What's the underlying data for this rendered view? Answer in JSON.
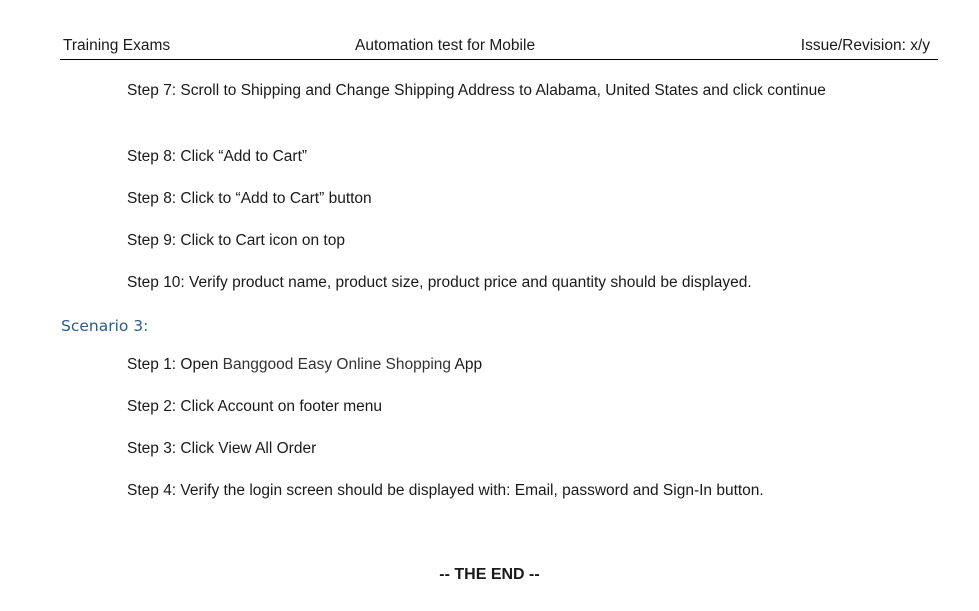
{
  "header": {
    "left": "Training Exams",
    "center": "Automation test for Mobile",
    "right": "Issue/Revision: x/y"
  },
  "steps_part1": [
    "Step 7: Scroll to Shipping and Change Shipping Address to Alabama, United States and click continue",
    "Step 8: Click “Add to Cart”",
    "Step 8: Click to “Add to Cart” button",
    "Step 9: Click to Cart icon on top",
    "Step 10: Verify product name, product size, product price and quantity should be displayed."
  ],
  "scenario3": {
    "heading": "Scenario 3:",
    "step1_prefix": "Step 1: Open ",
    "step1_app": "Banggood Easy Online Shopping",
    "step1_suffix": " App",
    "steps": [
      "Step 2: Click Account on footer menu",
      "Step 3: Click View All Order",
      "Step 4: Verify the login screen should be displayed with: Email, password and Sign-In button."
    ]
  },
  "footer": {
    "end_text": "-- THE END --"
  }
}
